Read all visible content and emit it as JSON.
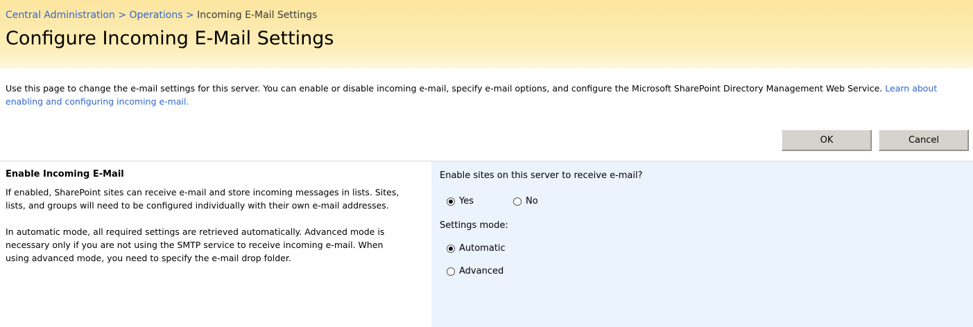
{
  "breadcrumb": {
    "items": [
      "Central Administration",
      "Operations"
    ],
    "separator": ">",
    "current": "Incoming E-Mail Settings"
  },
  "page": {
    "title": "Configure Incoming E-Mail Settings",
    "description": "Use this page to change the e-mail settings for this server. You can enable or disable incoming e-mail, specify e-mail options, and configure the Microsoft SharePoint Directory Management Web Service.",
    "description_link": "Learn about enabling and configuring incoming e-mail."
  },
  "buttons": {
    "ok": "OK",
    "cancel": "Cancel"
  },
  "section": {
    "heading": "Enable Incoming E-Mail",
    "paragraph1": "If enabled, SharePoint sites can receive e-mail and store incoming messages in lists. Sites, lists, and groups will need to be configured individually with their own e-mail addresses.",
    "paragraph2": "In automatic mode, all required settings are retrieved automatically. Advanced mode is necessary only if you are not using the SMTP service to receive incoming e-mail. When using advanced mode, you need to specify the e-mail drop folder."
  },
  "form": {
    "enable_label": "Enable sites on this server to receive e-mail?",
    "enable_options": {
      "yes": "Yes",
      "no": "No"
    },
    "enable_selected": "yes",
    "mode_label": "Settings mode:",
    "mode_options": {
      "automatic": "Automatic",
      "advanced": "Advanced"
    },
    "mode_selected": "automatic"
  },
  "colors": {
    "link": "#3366cc",
    "title_band": "#fce59f",
    "input_panel": "#ebf3fd",
    "button_face": "#d6d3ce"
  }
}
